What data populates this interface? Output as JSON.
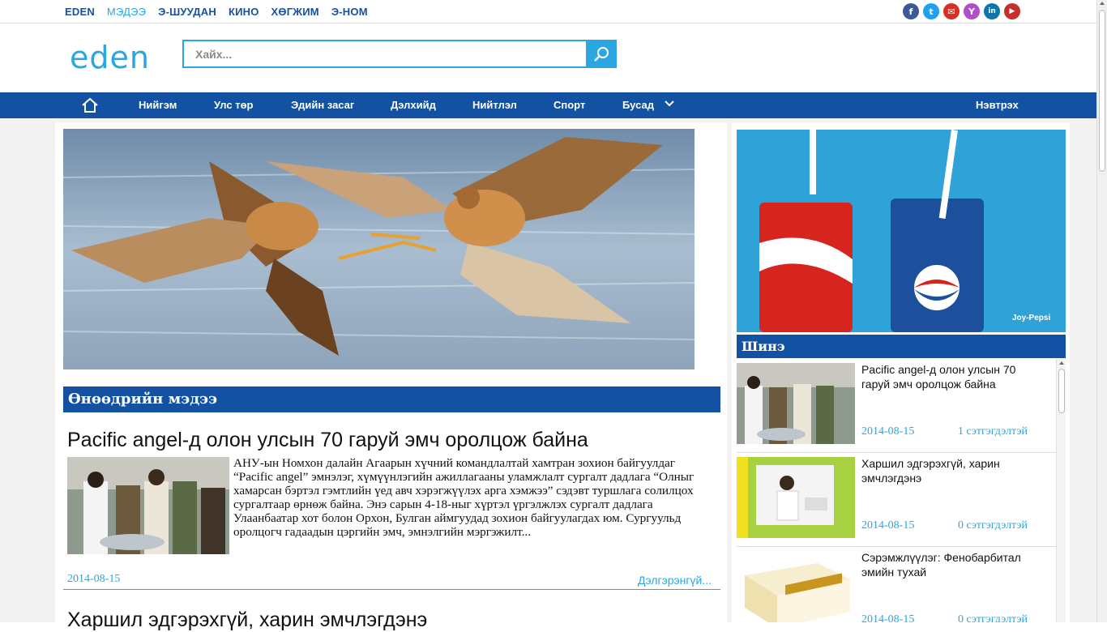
{
  "topbar": {
    "links": [
      "EDEN",
      "МЭДЭЭ",
      "Э-ШУУДАН",
      "КИНО",
      "ХӨГЖИМ",
      "Э-НОМ"
    ],
    "active": "МЭДЭЭ",
    "social": [
      {
        "name": "facebook-icon",
        "glyph": "f",
        "color": "#3b5998"
      },
      {
        "name": "twitter-icon",
        "glyph": "t",
        "color": "#1da1f2"
      },
      {
        "name": "mail-icon",
        "glyph": "✉",
        "color": "#d93025"
      },
      {
        "name": "yahoo-icon",
        "glyph": "Y",
        "color": "#b24ecb"
      },
      {
        "name": "linkedin-icon",
        "glyph": "in",
        "color": "#0e76a8"
      },
      {
        "name": "youtube-icon",
        "glyph": "▶",
        "color": "#c4302b"
      }
    ]
  },
  "header": {
    "logo": "eden",
    "search_placeholder": "Хайх..."
  },
  "nav": {
    "items": [
      "Нийгэм",
      "Улс төр",
      "Эдийн засаг",
      "Дэлхийд",
      "Нийтлэл",
      "Спорт",
      "Бусад"
    ],
    "login": "Нэвтрэх"
  },
  "main": {
    "section_title": "Өнөөдрийн мэдээ",
    "article": {
      "title": "Pacific angel-д олон улсын 70 гаруй эмч оролцож байна",
      "text": "АНУ-ын Номхон далайн Агаарын хүчний командлалтай хамтран зохион байгуулдаг “Pacific angel” эмнэлэг, хүмүүнлэгийн ажиллагааны уламжлалт сургалт дадлага “Олныг хамарсан бэртэл гэмтлийн үед авч хэрэгжүүлэх арга хэмжээ” сэдэвт туршлага солилцох сургалтаар өрнөж байна. Энэ сарын 4-18-ныг хүртэл үргэлжлэх сургалт дадлага Улаанбаатар хот болон Орхон, Булган аймгуудад зохион байгуулагдах юм. Сургуульд оролцогч гадаадын цэргийн эмч, эмнэлгийн мэргэжилт...",
      "date": "2014-08-15",
      "more": "Дэлгэрэнгүй..."
    },
    "article2_title": "Харшил эдгэрэхгүй, харин эмчлэгдэнэ"
  },
  "sidebar": {
    "section_title": "Шинэ",
    "news": [
      {
        "title": "Pacific angel-д олон улсын 70 гаруй эмч оролцож байна",
        "date": "2014-08-15",
        "comments": "1 сэтгэгдэлтэй"
      },
      {
        "title": "Харшил эдгэрэхгүй, харин эмчлэгдэнэ",
        "date": "2014-08-15",
        "comments": "0 сэтгэгдэлтэй"
      },
      {
        "title": "Сэрэмжлүүлэг: Фенобарбитал эмийн тухай",
        "date": "2014-08-15",
        "comments": "0 сэтгэгдэлтэй"
      }
    ]
  }
}
